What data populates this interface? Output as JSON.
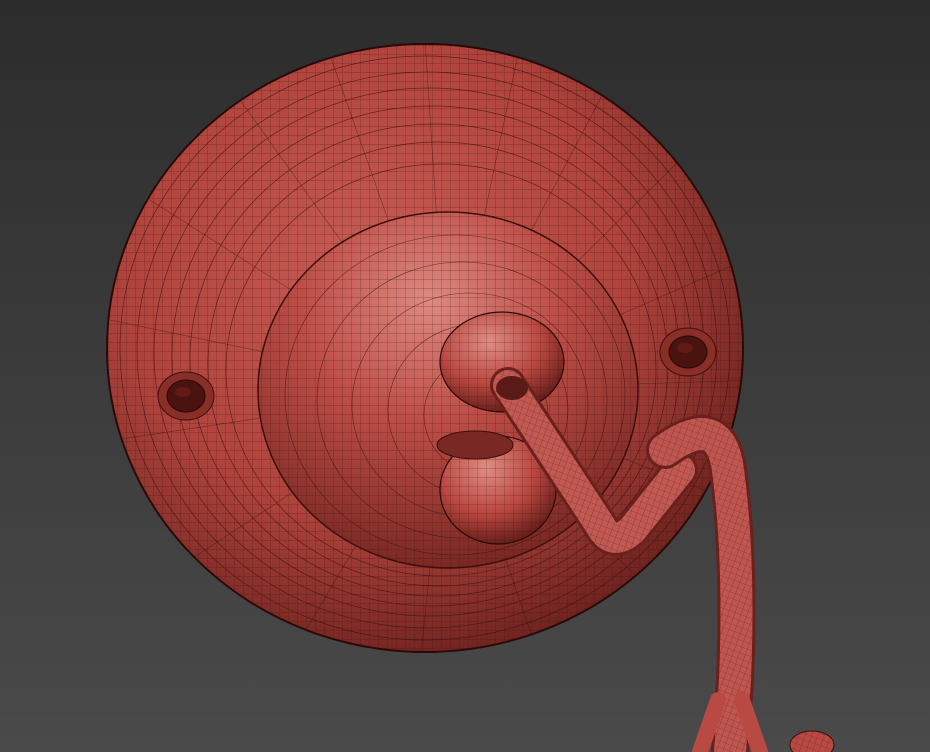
{
  "viewport": {
    "background_top": "#2c2c2c",
    "background_bottom": "#4a4a4a"
  },
  "model": {
    "material_color": "#b84a43",
    "material_shadow": "#6e231f",
    "material_highlight": "#d8807a",
    "wire_color": "#3a0f0c",
    "parts": [
      "ceiling-rose-plate",
      "dome",
      "screw-hole-left",
      "screw-hole-right",
      "knob",
      "hook-rod",
      "cable",
      "cable-end"
    ]
  }
}
